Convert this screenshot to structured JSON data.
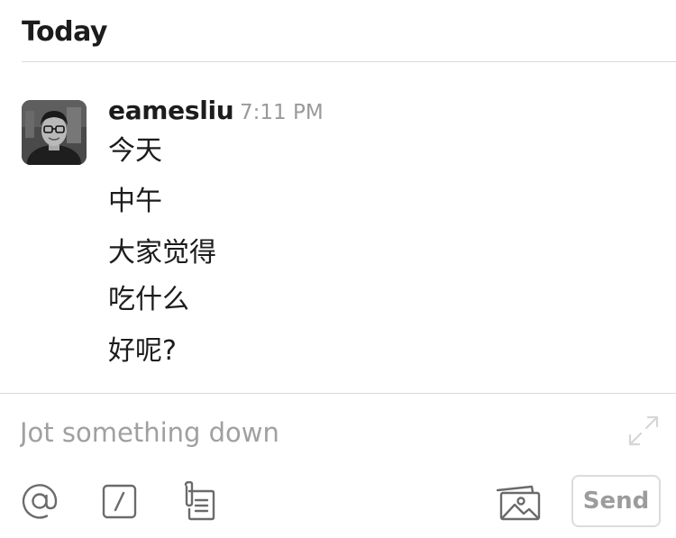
{
  "day_header": "Today",
  "message": {
    "sender": "eamesliu",
    "time": "7:11 PM",
    "lines": [
      "今天",
      "中午",
      "大家觉得",
      "吃什么",
      "好呢?"
    ]
  },
  "composer": {
    "placeholder": "Jot something down",
    "send_label": "Send"
  },
  "icons": {
    "mention": "at-sign-icon",
    "command": "slash-command-icon",
    "snippet": "clip-document-icon",
    "image": "photos-icon",
    "expand": "expand-icon"
  },
  "colors": {
    "text": "#1d1c1d",
    "muted": "#9a9a9a",
    "divider": "#d9d9d9",
    "icon": "#6b6b6b"
  }
}
